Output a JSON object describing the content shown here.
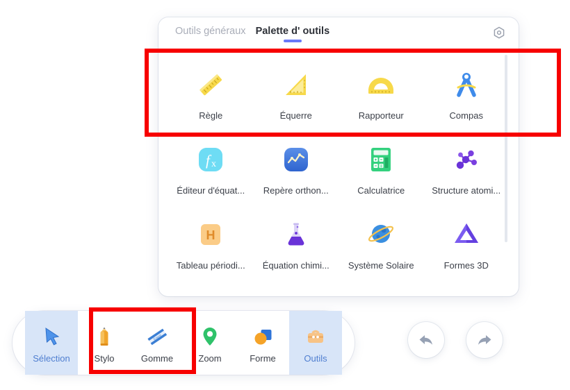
{
  "app": {
    "background_color": "#ffffff",
    "accent_color": "#6979f8",
    "highlight_color": "#d8e5f8",
    "annotation_color": "#f70000"
  },
  "panel": {
    "tabs": [
      {
        "label": "Outils généraux",
        "active": false
      },
      {
        "label": "Palette d'  outils",
        "active": true
      }
    ],
    "settings_icon": "gear-icon",
    "scrollbar": {
      "visible": true
    },
    "tools": [
      {
        "label": "Règle",
        "icon": "ruler-icon",
        "color": "#f5d33a"
      },
      {
        "label": "Équerre",
        "icon": "set-square-icon",
        "color": "#f5d33a"
      },
      {
        "label": "Rapporteur",
        "icon": "protractor-icon",
        "color": "#f5d33a"
      },
      {
        "label": "Compas",
        "icon": "compass-icon",
        "color": "#4a90e2"
      },
      {
        "label": "Éditeur d'équat...",
        "icon": "equation-editor-icon",
        "color": "#4fd0f0"
      },
      {
        "label": "Repère orthon...",
        "icon": "coordinate-graph-icon",
        "color": "#3b6fd4"
      },
      {
        "label": "Calculatrice",
        "icon": "calculator-icon",
        "color": "#2fd47c"
      },
      {
        "label": "Structure atomi...",
        "icon": "atomic-structure-icon",
        "color": "#6a33d8"
      },
      {
        "label": "Tableau périodi...",
        "icon": "periodic-table-icon",
        "color": "#f5b352"
      },
      {
        "label": "Équation chimi...",
        "icon": "chemistry-flask-icon",
        "color": "#6a33d8"
      },
      {
        "label": "Système Solaire",
        "icon": "planet-icon",
        "color": "#3b8fe0"
      },
      {
        "label": "Formes 3D",
        "icon": "3d-shapes-icon",
        "color": "#7b5cf0"
      }
    ]
  },
  "toolbar": {
    "items": [
      {
        "label": "Sélection",
        "icon": "cursor-arrow-icon",
        "active": true
      },
      {
        "label": "Stylo",
        "icon": "pen-icon",
        "active": false
      },
      {
        "label": "Gomme",
        "icon": "eraser-icon",
        "active": false
      },
      {
        "label": "Zoom",
        "icon": "map-pin-icon",
        "active": false
      },
      {
        "label": "Forme",
        "icon": "shapes-icon",
        "active": false
      },
      {
        "label": "Outils",
        "icon": "toolbox-icon",
        "active": true
      }
    ],
    "undo": {
      "name": "undo-button",
      "icon": "undo-arrow-icon"
    },
    "redo": {
      "name": "redo-button",
      "icon": "redo-arrow-icon"
    }
  },
  "annotations": [
    {
      "name": "annotation-tools-row",
      "target": "first tool row (Règle, Équerre, Rapporteur, Compas)"
    },
    {
      "name": "annotation-pen-eraser",
      "target": "Stylo and Gomme toolbar buttons"
    }
  ]
}
